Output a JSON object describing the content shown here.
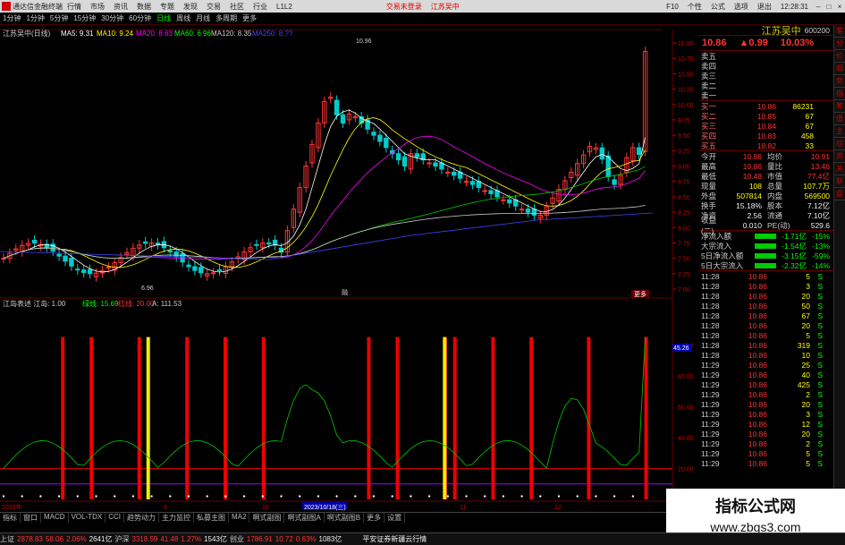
{
  "title_bar": {
    "app_name": "通达信金融终端",
    "menu": [
      "行情",
      "市场",
      "资讯",
      "数据",
      "专题",
      "发现",
      "交易",
      "社区",
      "行业",
      "L1L2"
    ],
    "trade_status": "交易未登录",
    "stock_short": "江苏吴中",
    "right_items": [
      "F10",
      "个性",
      "公式",
      "选项",
      "退出"
    ],
    "clock": "12:28:31"
  },
  "period_bar": [
    "1分钟",
    "1分钟",
    "5分钟",
    "15分钟",
    "30分钟",
    "60分钟",
    "日线",
    "周线",
    "月线",
    "多周期",
    "更多"
  ],
  "period_selected": "日线",
  "kline_header": {
    "name": "江苏吴中(日线)",
    "ma5": "MA5: 9.31",
    "ma10": "MA10: 9.24",
    "ma20": "MA20: 8.63",
    "ma60": "MA60: 6.96",
    "ma120": "MA120: 8.35",
    "ma250": "MA250: 8.??"
  },
  "kline_labels": {
    "high_mark": "10.96",
    "low_mark": "6.96",
    "tag": "融",
    "tag2": "更多"
  },
  "price_axis": [
    "11.00",
    "10.75",
    "10.50",
    "10.25",
    "10.00",
    "9.75",
    "9.50",
    "9.25",
    "9.00",
    "8.75",
    "8.50",
    "8.25",
    "8.00",
    "7.75",
    "7.50",
    "7.25",
    "7.00"
  ],
  "indicator_header": {
    "name": "江岛表述 江岛: 1.00",
    "v1": "绿线: 15.69",
    "v2": "红线: 20.00",
    "v3": "A: 111.53"
  },
  "indicator_axis": [
    "100.0",
    "80.00",
    "60.00",
    "40.00",
    "20.00"
  ],
  "indicator_note": "45.26",
  "date_axis": {
    "start": "2023年",
    "m9": "9",
    "m10": "10",
    "sel": "2023/10/18(三)",
    "m11": "11",
    "m12": "12"
  },
  "chart_data": {
    "type": "candlestick",
    "price_range": [
      7.0,
      11.0
    ],
    "indicator_range": [
      0,
      110
    ],
    "red_vertical_bars_x_index": [
      6,
      9,
      14,
      19,
      23,
      27,
      38,
      41,
      46,
      47,
      51,
      55,
      61,
      67
    ],
    "yellow_vertical_bars_x_index": [
      14,
      45
    ]
  },
  "quote": {
    "name": "江苏吴中",
    "code": "600200",
    "price": "10.86",
    "change": "▲0.99",
    "pct": "10.03%",
    "sell": [
      {
        "label": "卖五",
        "price": "",
        "vol": ""
      },
      {
        "label": "卖四",
        "price": "",
        "vol": ""
      },
      {
        "label": "卖三",
        "price": "",
        "vol": ""
      },
      {
        "label": "卖二",
        "price": "",
        "vol": ""
      },
      {
        "label": "卖一",
        "price": "",
        "vol": ""
      }
    ],
    "buy": [
      {
        "label": "买一",
        "price": "10.86",
        "vol": "86231"
      },
      {
        "label": "买二",
        "price": "10.85",
        "vol": "67"
      },
      {
        "label": "买三",
        "price": "10.84",
        "vol": "67"
      },
      {
        "label": "买四",
        "price": "10.83",
        "vol": "458"
      },
      {
        "label": "买五",
        "price": "10.82",
        "vol": "33"
      }
    ],
    "stats": [
      {
        "k": "今开",
        "v": "10.86",
        "k2": "均价",
        "v2": "10.91"
      },
      {
        "k": "最高",
        "v": "10.86",
        "k2": "量比",
        "v2": "13.46"
      },
      {
        "k": "最低",
        "v": "10.48",
        "k2": "市值",
        "v2": "77.4亿"
      },
      {
        "k": "现量",
        "v": "108",
        "k2": "总量",
        "v2": "107.7万"
      },
      {
        "k": "外盘",
        "v": "507814",
        "k2": "内盘",
        "v2": "569500"
      },
      {
        "k": "换手",
        "v": "15.18%",
        "k2": "股本",
        "v2": "7.12亿"
      },
      {
        "k": "净资",
        "v": "2.56",
        "k2": "流通",
        "v2": "7.10亿"
      },
      {
        "k": "收益(二)",
        "v": "0.010",
        "k2": "PE(动)",
        "v2": "529.6"
      }
    ],
    "flows": [
      {
        "k": "净流入额",
        "v": "-1.71亿",
        "p": "-15%"
      },
      {
        "k": "大宗流入",
        "v": "-1.54亿",
        "p": "-13%"
      },
      {
        "k": "5日净流入额",
        "v": "-3.15亿",
        "p": "-59%"
      },
      {
        "k": "5日大宗流入",
        "v": "-2.32亿",
        "p": "-14%"
      }
    ],
    "ticks": [
      {
        "t": "11:28",
        "p": "10.86",
        "v": "5",
        "s": "S"
      },
      {
        "t": "11:28",
        "p": "10.86",
        "v": "3",
        "s": "S"
      },
      {
        "t": "11:28",
        "p": "10.86",
        "v": "20",
        "s": "S"
      },
      {
        "t": "11:28",
        "p": "10.86",
        "v": "50",
        "s": "S"
      },
      {
        "t": "11:28",
        "p": "10.86",
        "v": "67",
        "s": "S"
      },
      {
        "t": "11:28",
        "p": "10.86",
        "v": "20",
        "s": "S"
      },
      {
        "t": "11:28",
        "p": "10.86",
        "v": "5",
        "s": "S"
      },
      {
        "t": "11:28",
        "p": "10.86",
        "v": "319",
        "s": "S"
      },
      {
        "t": "11:28",
        "p": "10.86",
        "v": "10",
        "s": "S"
      },
      {
        "t": "11:29",
        "p": "10.86",
        "v": "25",
        "s": "S"
      },
      {
        "t": "11:29",
        "p": "10.86",
        "v": "40",
        "s": "S"
      },
      {
        "t": "11:29",
        "p": "10.86",
        "v": "425",
        "s": "S"
      },
      {
        "t": "11:29",
        "p": "10.86",
        "v": "2",
        "s": "S"
      },
      {
        "t": "11:29",
        "p": "10.86",
        "v": "20",
        "s": "S"
      },
      {
        "t": "11:29",
        "p": "10.86",
        "v": "3",
        "s": "S"
      },
      {
        "t": "11:29",
        "p": "10.86",
        "v": "12",
        "s": "S"
      },
      {
        "t": "11:29",
        "p": "10.86",
        "v": "20",
        "s": "S"
      },
      {
        "t": "11:29",
        "p": "10.86",
        "v": "2",
        "s": "S"
      },
      {
        "t": "11:29",
        "p": "10.86",
        "v": "5",
        "s": "S"
      },
      {
        "t": "11:29",
        "p": "10.86",
        "v": "5",
        "s": "S"
      }
    ]
  },
  "side_tabs": [
    "笔",
    "分",
    "价",
    "细",
    "势",
    "指",
    "筹",
    "值",
    "主",
    "综",
    "资",
    "关",
    "联",
    "盘"
  ],
  "tabs": [
    "指标",
    "窗口",
    "MACD",
    "VOL-TDX",
    "CCI",
    "趋势动力",
    "主力监控",
    "私募主图",
    "MA2",
    "啊式副图",
    "啊式副图A",
    "啊式副图B",
    "更多",
    "设置"
  ],
  "status": [
    {
      "text": "上证",
      "c": "gry"
    },
    {
      "text": "2878.83",
      "c": "red"
    },
    {
      "text": "58.06",
      "c": "red"
    },
    {
      "text": "2.06%",
      "c": "red"
    },
    {
      "text": "2641亿",
      "c": "wht"
    },
    {
      "text": "沪深",
      "c": "gry"
    },
    {
      "text": "3318.59",
      "c": "red"
    },
    {
      "text": "41.48",
      "c": "red"
    },
    {
      "text": "1.27%",
      "c": "red"
    },
    {
      "text": "1543亿",
      "c": "wht"
    },
    {
      "text": "创业",
      "c": "gry"
    },
    {
      "text": "1786.91",
      "c": "red"
    },
    {
      "text": "10.72",
      "c": "red"
    },
    {
      "text": "0.63%",
      "c": "red"
    },
    {
      "text": "1083亿",
      "c": "wht"
    },
    {
      "text": "平安证券新疆云行情",
      "c": "wht"
    }
  ],
  "watermark": {
    "line1": "指标公式网",
    "line2": "www.zbgs3.com"
  }
}
